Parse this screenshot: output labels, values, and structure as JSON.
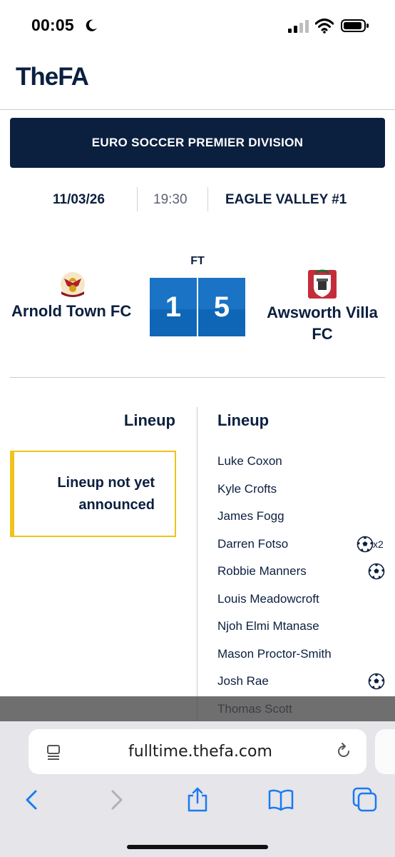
{
  "status_bar": {
    "time": "00:05"
  },
  "header": {
    "logo_text": "TheFA"
  },
  "match": {
    "competition": "EURO SOCCER PREMIER DIVISION",
    "date": "11/03/26",
    "time": "19:30",
    "venue": "EAGLE VALLEY #1",
    "status": "FT",
    "home": {
      "name": "Arnold Town FC",
      "score": "1"
    },
    "away": {
      "name": "Awsworth Villa FC",
      "score": "5"
    }
  },
  "lineups": {
    "home": {
      "title": "Lineup",
      "message": "Lineup not yet announced"
    },
    "away": {
      "title": "Lineup",
      "players": [
        {
          "name": "Luke Coxon",
          "goals": 0
        },
        {
          "name": "Kyle Crofts",
          "goals": 0
        },
        {
          "name": "James Fogg",
          "goals": 0
        },
        {
          "name": "Darren Fotso",
          "goals": 2,
          "goal_label": "x2"
        },
        {
          "name": "Robbie Manners",
          "goals": 1
        },
        {
          "name": "Louis Meadowcroft",
          "goals": 0
        },
        {
          "name": "Njoh Elmi Mtanase",
          "goals": 0
        },
        {
          "name": "Mason Proctor-Smith",
          "goals": 0
        },
        {
          "name": "Josh Rae",
          "goals": 1
        },
        {
          "name": "Thomas Scott",
          "goals": 0
        }
      ]
    }
  },
  "browser": {
    "url": "fulltime.thefa.com"
  },
  "colors": {
    "navy": "#0b1f3f",
    "score_blue": "#0f66b6",
    "highlight_yellow": "#f0c21b"
  }
}
